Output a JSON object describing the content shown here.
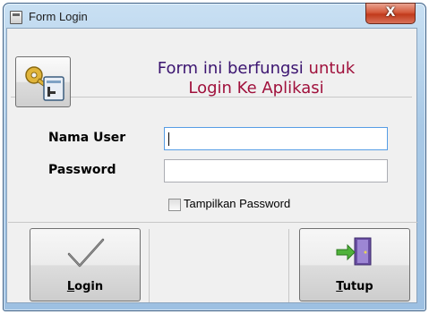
{
  "window": {
    "title": "Form Login",
    "close_label": "X"
  },
  "header": {
    "line1_part1": "Form ini berfungsi ",
    "line1_part2": "untuk",
    "line2": "Login Ke Aplikasi"
  },
  "form": {
    "username_label": "Nama User",
    "username_value": "",
    "password_label": "Password",
    "password_value": "",
    "show_password_label": "Tampilkan Password",
    "show_password_checked": false
  },
  "buttons": {
    "login_mnemonic": "L",
    "login_rest": "ogin",
    "close_mnemonic": "T",
    "close_rest": "utup"
  },
  "icons": {
    "title": "form-icon",
    "header": "key-id-card-icon",
    "login": "checkmark-icon",
    "close": "exit-door-icon"
  },
  "colors": {
    "header_text_primary": "#3b1470",
    "header_text_accent": "#a0113c",
    "close_button": "#c13a1b"
  }
}
